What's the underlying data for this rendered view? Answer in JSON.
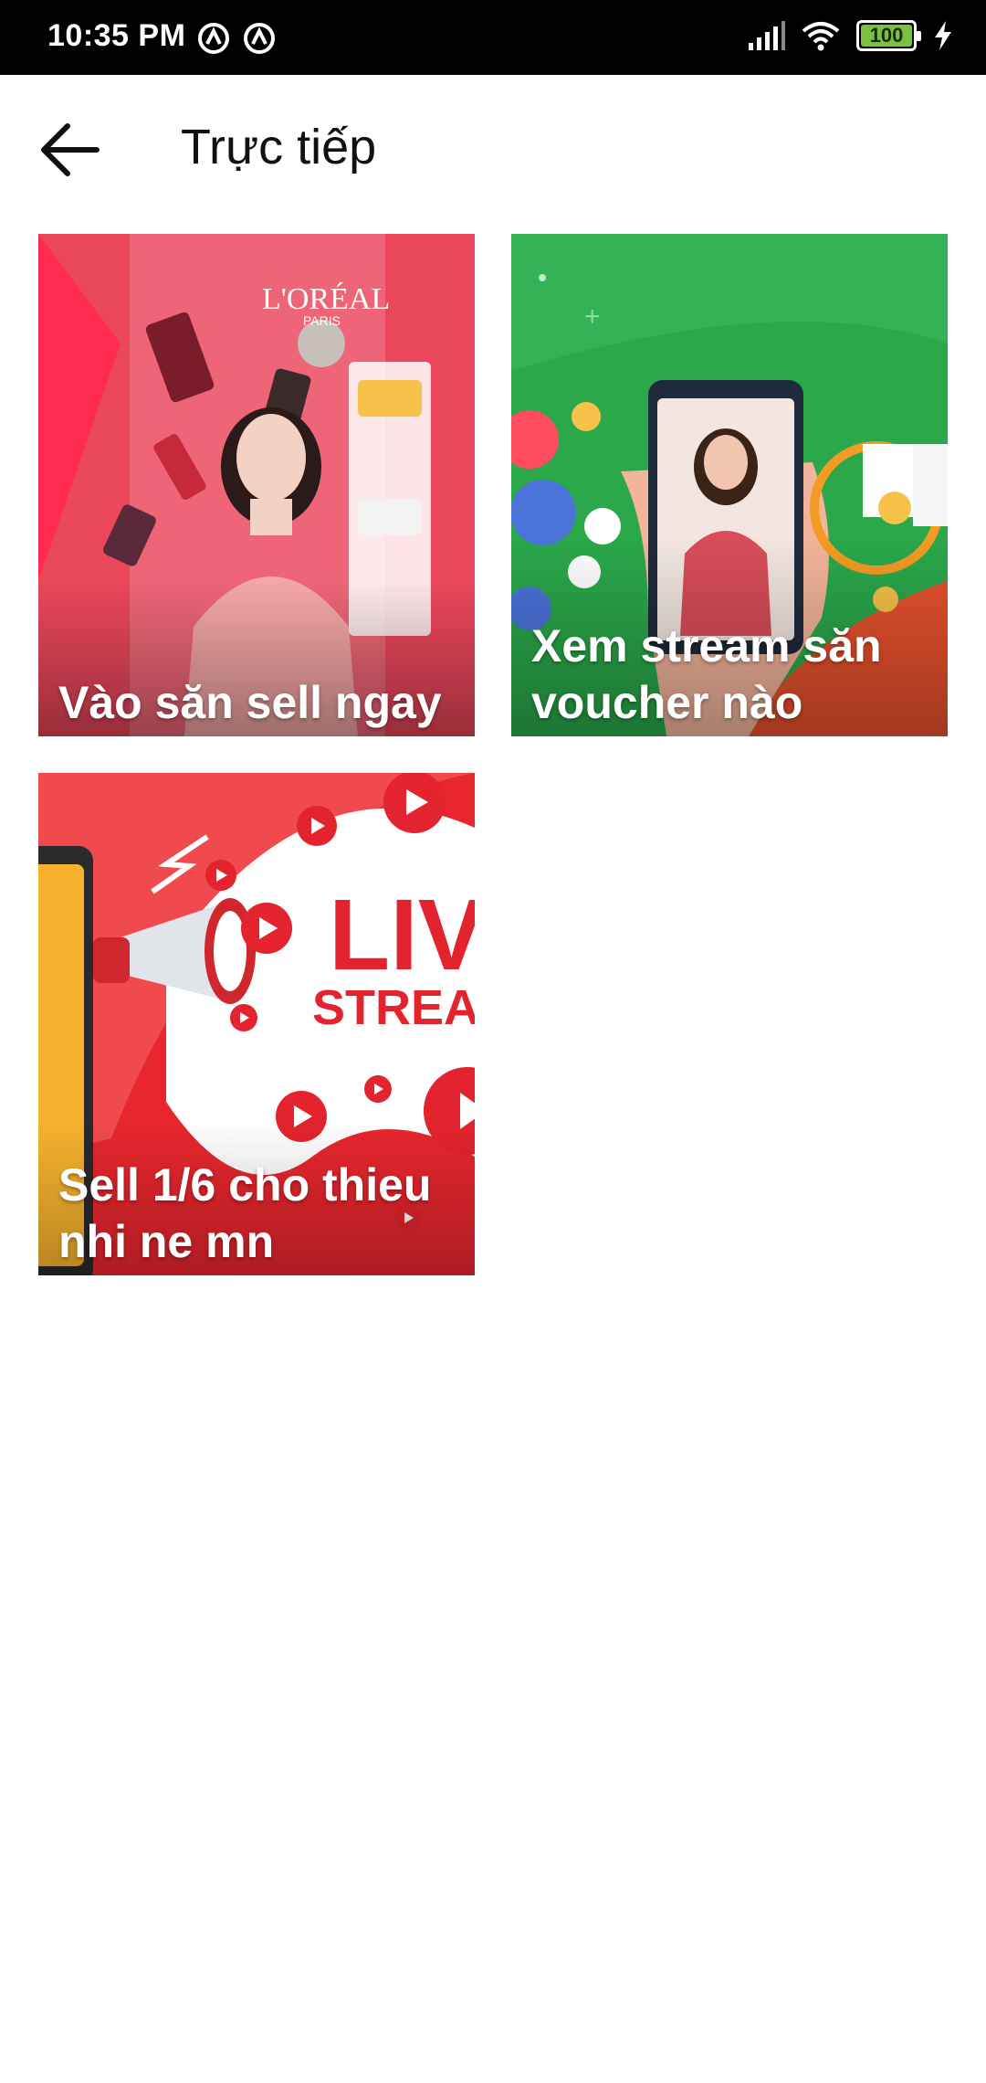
{
  "status_bar": {
    "time": "10:35 PM",
    "left_icons": [
      "notification-app-icon",
      "notification-app-icon"
    ],
    "right_icons": [
      "signal-icon",
      "wifi-icon",
      "battery-icon",
      "charging-icon"
    ],
    "battery_level": "100",
    "battery_fraction": 1.0
  },
  "app_bar": {
    "back_icon": "arrow-left-icon",
    "title": "Trực tiếp"
  },
  "cards": [
    {
      "caption": "Vào săn sell ngay",
      "theme": "red-cosmetics-livestream"
    },
    {
      "caption": "Xem stream săn voucher nào",
      "theme": "green-phone-livestream"
    },
    {
      "caption": "Sell 1/6 cho thieu nhi ne mn",
      "theme": "red-megaphone-livestream"
    }
  ],
  "card_image_texts": {
    "card1_brand": "L'ORÉAL",
    "card1_brand_sub": "PARIS",
    "card3_big_1": "LIV",
    "card3_big_2": "STREA"
  },
  "colors": {
    "status_bar_bg": "#000000",
    "battery_fill": "#7bc043",
    "card1_bg": "#e8354a",
    "card2_bg": "#2aa84a",
    "card3_bg": "#e8262e"
  }
}
